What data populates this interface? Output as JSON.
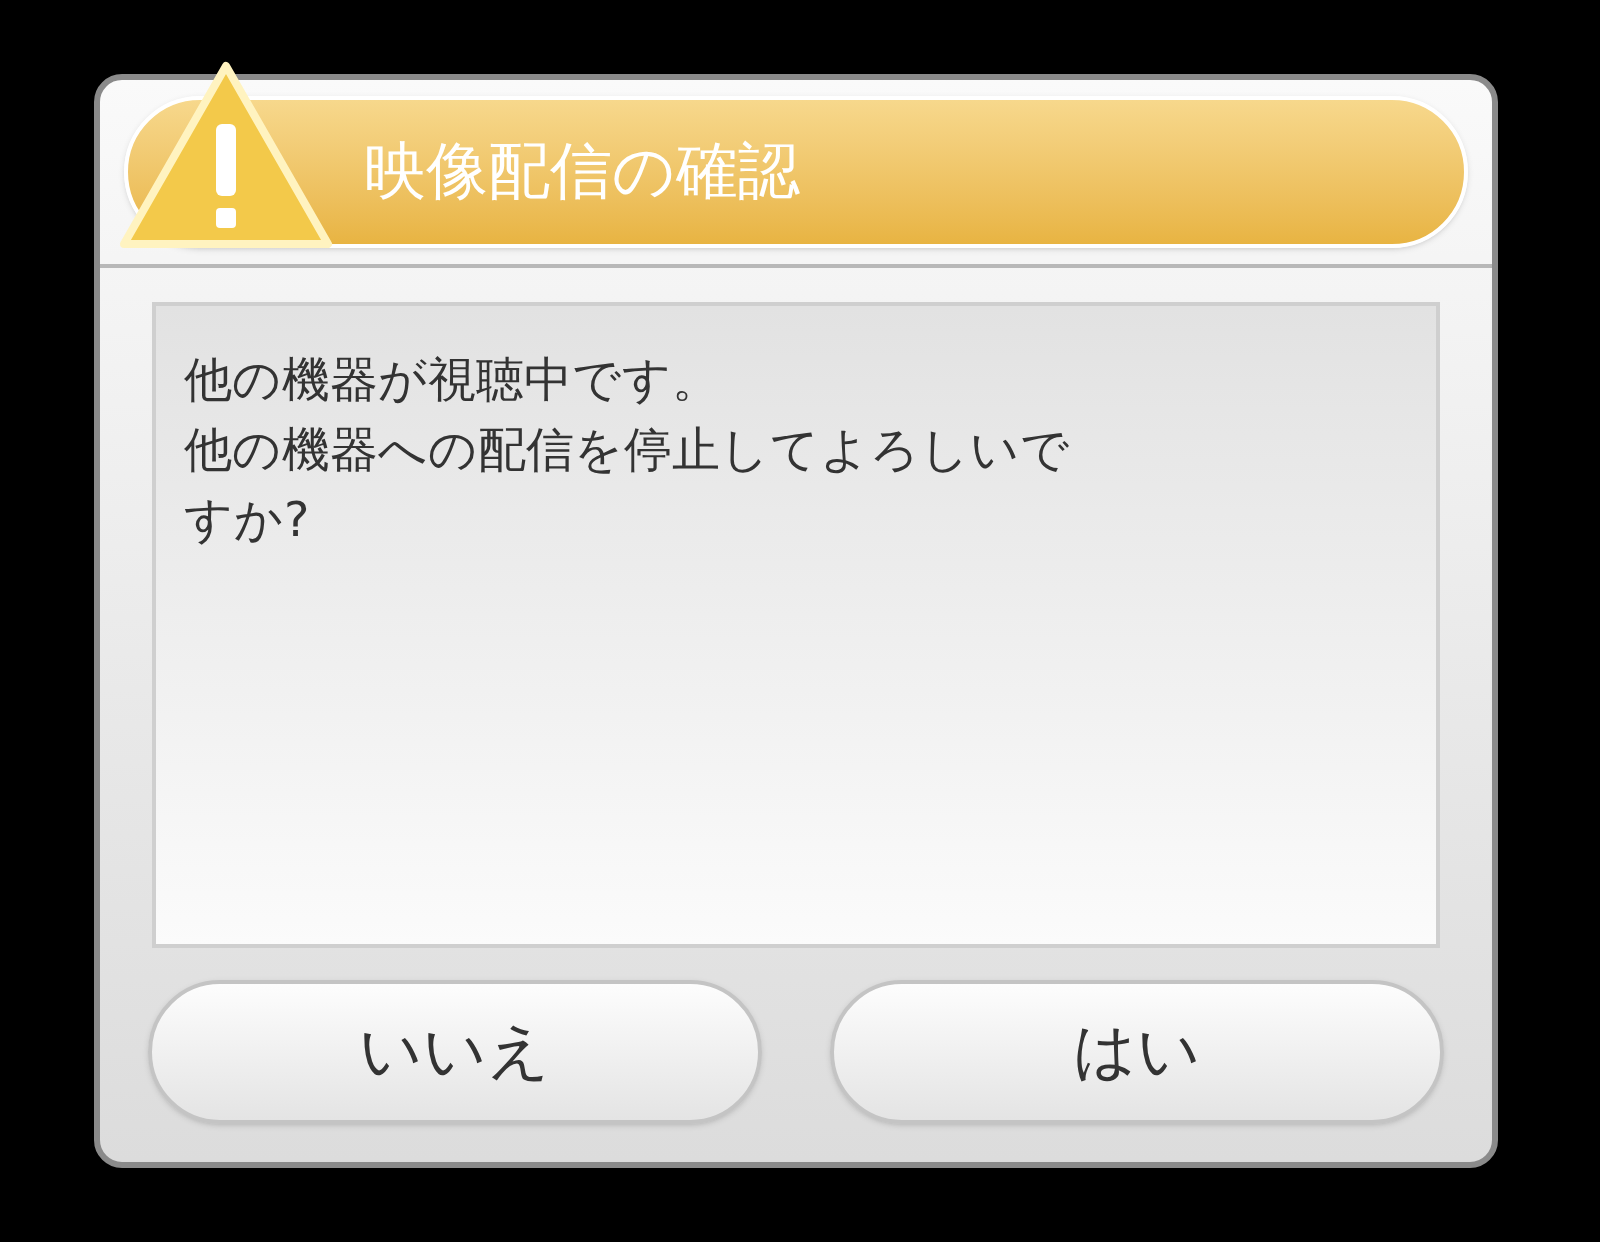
{
  "dialog": {
    "title": "映像配信の確認",
    "message_lines": [
      "他の機器が視聴中です。",
      "他の機器への配信を停止してよろしいで",
      "すか?"
    ],
    "buttons": [
      {
        "label": "いいえ"
      },
      {
        "label": "はい"
      }
    ]
  }
}
